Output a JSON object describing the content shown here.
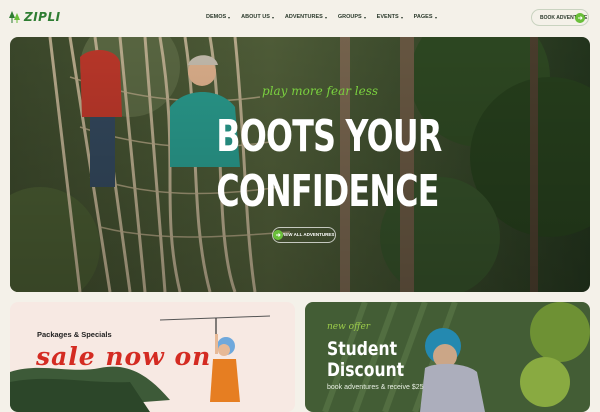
{
  "brand": {
    "name": "ZIPLI",
    "accent": "#6abf3a",
    "dark": "#2b3a2c"
  },
  "nav": {
    "items": [
      {
        "label": "DEMOS"
      },
      {
        "label": "ABOUT US"
      },
      {
        "label": "ADVENTURES"
      },
      {
        "label": "GROUPS"
      },
      {
        "label": "EVENTS"
      },
      {
        "label": "PAGES"
      }
    ],
    "cta_label": "BOOK ADVENTURE",
    "cta_icon": "arrow-right-icon"
  },
  "hero": {
    "tagline": "play more fear less",
    "headline_line1": "BOOTS YOUR",
    "headline_line2": "CONFIDENCE",
    "button_label": "VIEW ALL ADVENTURES",
    "button_icon": "arrow-right-icon"
  },
  "promo_left": {
    "title": "Packages & Specials",
    "script": "sale now on",
    "color": "#d42b22"
  },
  "promo_right": {
    "kicker": "new offer",
    "title_line1": "Student",
    "title_line2": "Discount",
    "subtitle": "book adventures & receive $25"
  }
}
